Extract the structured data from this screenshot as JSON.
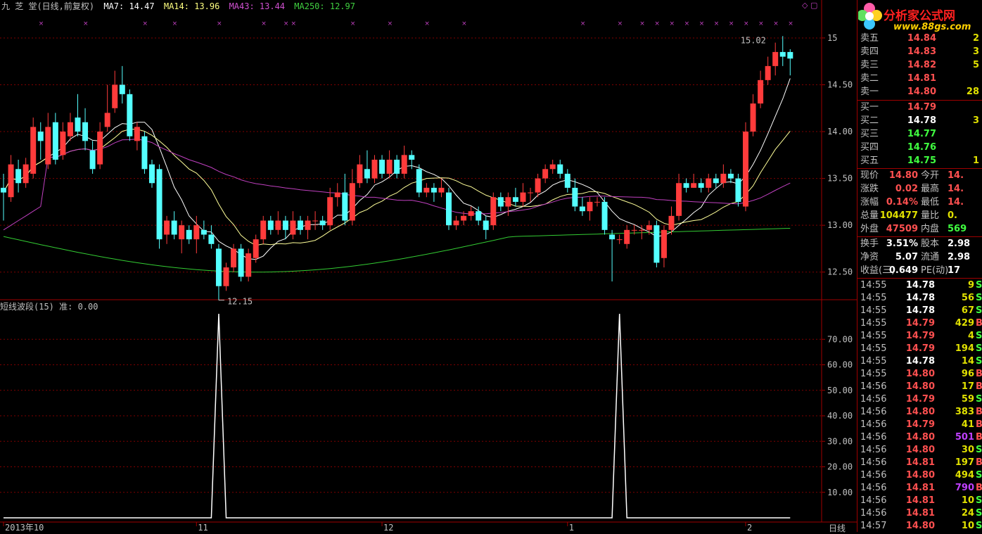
{
  "header": {
    "name": "九 芝 堂(日线,前复权)",
    "ma7": "MA7: 14.47",
    "ma14": "MA14: 13.96",
    "ma43": "MA43: 13.44",
    "ma250": "MA250: 12.97"
  },
  "indicator_title": "短线波段(15) 准: 0.00",
  "period_label": "日线",
  "colors": {
    "up": "#ff3b3b",
    "down": "#54ffff",
    "ma7": "#ffffff",
    "ma14": "#ffff99",
    "ma43": "#c040c0",
    "ma250": "#33cc33",
    "grid": "#800000"
  },
  "chart_data": [
    {
      "type": "candlestick",
      "price_axis": {
        "ticks": [
          15,
          14.5,
          14,
          13.5,
          13,
          12.5
        ],
        "tick_labels": [
          "15",
          "14.50",
          "14.00",
          "13.50",
          "13.00",
          "12.50"
        ],
        "range": [
          12.22,
          15.27
        ]
      },
      "x_ticks": [
        "2013年10",
        "11",
        "12",
        "1",
        "2"
      ],
      "annotations": [
        "12.15",
        "15.02"
      ],
      "candles": [
        [
          13.4,
          13.35,
          13.55,
          13.05
        ],
        [
          13.3,
          13.65,
          13.75,
          13.25
        ],
        [
          13.6,
          13.45,
          13.7,
          13.35
        ],
        [
          13.45,
          13.65,
          13.72,
          13.4
        ],
        [
          13.55,
          14.05,
          14.15,
          13.5
        ],
        [
          14.0,
          13.9,
          14.1,
          13.7
        ],
        [
          13.65,
          14.05,
          14.2,
          13.6
        ],
        [
          14.1,
          13.7,
          14.2,
          13.65
        ],
        [
          13.75,
          14.0,
          14.1,
          13.7
        ],
        [
          13.95,
          14.1,
          14.2,
          13.9
        ],
        [
          14.15,
          14.0,
          14.4,
          13.95
        ],
        [
          14.1,
          13.9,
          14.25,
          13.8
        ],
        [
          13.8,
          13.6,
          13.9,
          13.55
        ],
        [
          13.65,
          14.0,
          14.1,
          13.6
        ],
        [
          14.05,
          14.2,
          14.5,
          14.0
        ],
        [
          14.25,
          14.5,
          14.65,
          14.2
        ],
        [
          14.5,
          14.4,
          14.7,
          14.3
        ],
        [
          14.4,
          13.95,
          14.45,
          13.9
        ],
        [
          13.9,
          14.05,
          14.1,
          13.8
        ],
        [
          13.95,
          13.6,
          14.0,
          13.55
        ],
        [
          13.65,
          13.45,
          13.7,
          13.4
        ],
        [
          13.6,
          12.85,
          13.65,
          12.75
        ],
        [
          12.9,
          13.05,
          13.1,
          12.8
        ],
        [
          13.05,
          12.9,
          13.15,
          12.85
        ],
        [
          12.85,
          13.0,
          13.05,
          12.7
        ],
        [
          12.95,
          12.85,
          13.0,
          12.8
        ],
        [
          12.85,
          13.0,
          13.1,
          12.7
        ],
        [
          12.95,
          12.9,
          13.05,
          12.85
        ],
        [
          12.9,
          12.8,
          13.0,
          12.75
        ],
        [
          12.75,
          12.35,
          12.8,
          12.2
        ],
        [
          12.35,
          12.55,
          12.6,
          12.3
        ],
        [
          12.55,
          12.75,
          12.8,
          12.5
        ],
        [
          12.75,
          12.45,
          12.8,
          12.4
        ],
        [
          12.45,
          12.7,
          12.75,
          12.4
        ],
        [
          12.65,
          12.85,
          12.9,
          12.6
        ],
        [
          12.85,
          13.05,
          13.1,
          12.8
        ],
        [
          13.05,
          12.95,
          13.1,
          12.9
        ],
        [
          12.95,
          13.05,
          13.15,
          12.9
        ],
        [
          13.05,
          12.95,
          13.1,
          12.85
        ],
        [
          12.9,
          13.05,
          13.15,
          12.85
        ],
        [
          13.05,
          12.95,
          13.1,
          12.9
        ],
        [
          12.95,
          13.05,
          13.1,
          12.85
        ],
        [
          13.05,
          13.05,
          13.15,
          12.95
        ],
        [
          13.05,
          13.0,
          13.1,
          12.95
        ],
        [
          13.0,
          13.3,
          13.4,
          12.95
        ],
        [
          13.3,
          13.35,
          13.45,
          13.2
        ],
        [
          13.35,
          13.05,
          13.55,
          13.0
        ],
        [
          13.05,
          13.45,
          13.6,
          13.0
        ],
        [
          13.45,
          13.65,
          13.75,
          13.4
        ],
        [
          13.6,
          13.5,
          13.8,
          13.45
        ],
        [
          13.5,
          13.7,
          13.75,
          13.45
        ],
        [
          13.7,
          13.55,
          13.75,
          13.5
        ],
        [
          13.55,
          13.7,
          13.8,
          13.5
        ],
        [
          13.7,
          13.55,
          13.75,
          13.5
        ],
        [
          13.55,
          13.75,
          13.85,
          13.5
        ],
        [
          13.75,
          13.7,
          13.8,
          13.6
        ],
        [
          13.6,
          13.35,
          13.65,
          13.3
        ],
        [
          13.35,
          13.4,
          13.45,
          13.3
        ],
        [
          13.4,
          13.35,
          13.45,
          13.25
        ],
        [
          13.35,
          13.4,
          13.5,
          13.3
        ],
        [
          13.35,
          13.0,
          13.4,
          12.95
        ],
        [
          13.0,
          13.05,
          13.1,
          12.95
        ],
        [
          13.05,
          13.1,
          13.15,
          13.0
        ],
        [
          13.1,
          13.15,
          13.2,
          13.05
        ],
        [
          13.15,
          13.05,
          13.2,
          13.0
        ],
        [
          13.05,
          12.95,
          13.1,
          12.85
        ],
        [
          13.0,
          13.3,
          13.35,
          12.95
        ],
        [
          13.3,
          13.2,
          13.35,
          13.15
        ],
        [
          13.2,
          13.3,
          13.35,
          13.1
        ],
        [
          13.3,
          13.25,
          13.4,
          13.2
        ],
        [
          13.25,
          13.35,
          13.45,
          13.2
        ],
        [
          13.35,
          13.35,
          13.4,
          13.25
        ],
        [
          13.35,
          13.5,
          13.55,
          13.3
        ],
        [
          13.5,
          13.6,
          13.65,
          13.45
        ],
        [
          13.6,
          13.65,
          13.7,
          13.55
        ],
        [
          13.65,
          13.55,
          13.7,
          13.5
        ],
        [
          13.55,
          13.4,
          13.6,
          13.35
        ],
        [
          13.4,
          13.2,
          13.5,
          13.15
        ],
        [
          13.2,
          13.15,
          13.3,
          13.1
        ],
        [
          13.15,
          13.25,
          13.3,
          13.05
        ],
        [
          13.25,
          13.25,
          13.3,
          13.2
        ],
        [
          13.25,
          12.95,
          13.3,
          12.9
        ],
        [
          12.9,
          12.85,
          12.95,
          12.4
        ],
        [
          12.85,
          12.85,
          12.9,
          12.8
        ],
        [
          12.8,
          12.95,
          13.0,
          12.75
        ],
        [
          12.95,
          12.95,
          13.0,
          12.9
        ],
        [
          12.95,
          12.95,
          13.0,
          12.85
        ],
        [
          12.95,
          13.0,
          13.05,
          12.9
        ],
        [
          13.0,
          12.6,
          13.05,
          12.55
        ],
        [
          12.65,
          12.95,
          13.0,
          12.55
        ],
        [
          12.95,
          13.1,
          13.2,
          12.9
        ],
        [
          13.1,
          13.45,
          13.55,
          13.05
        ],
        [
          13.45,
          13.4,
          13.5,
          13.35
        ],
        [
          13.4,
          13.45,
          13.55,
          13.4
        ],
        [
          13.45,
          13.4,
          13.5,
          13.35
        ],
        [
          13.4,
          13.5,
          13.55,
          13.35
        ],
        [
          13.5,
          13.45,
          13.55,
          13.4
        ],
        [
          13.45,
          13.55,
          13.65,
          13.4
        ],
        [
          13.55,
          13.5,
          13.6,
          13.45
        ],
        [
          13.5,
          13.25,
          13.55,
          13.2
        ],
        [
          13.2,
          14.0,
          14.1,
          13.15
        ],
        [
          14.0,
          14.3,
          14.4,
          13.95
        ],
        [
          14.3,
          14.55,
          14.65,
          14.25
        ],
        [
          14.55,
          14.7,
          14.8,
          14.5
        ],
        [
          14.7,
          14.85,
          14.95,
          14.6
        ],
        [
          14.85,
          14.8,
          15.02,
          14.7
        ],
        [
          14.85,
          14.78,
          14.88,
          14.6
        ]
      ],
      "ma_values_last": {
        "MA7": 14.47,
        "MA14": 13.96,
        "MA43": 13.44,
        "MA250": 12.97
      }
    },
    {
      "type": "line",
      "name": "短线波段",
      "y_ticks": [
        10,
        20,
        30,
        40,
        50,
        60,
        70
      ],
      "y_tick_labels": [
        "10.00",
        "20.00",
        "30.00",
        "40.00",
        "50.00",
        "60.00",
        "70.00"
      ],
      "y_range": [
        0,
        80
      ],
      "spikes": [
        {
          "index": 29,
          "value": 80
        },
        {
          "index": 83,
          "value": 80
        }
      ],
      "baseline": 0
    }
  ],
  "panel": {
    "logo": "分析家公式网",
    "logo_url": "www.88gs.com",
    "sell": [
      {
        "label": "卖五",
        "price": "14.84",
        "qty": "2"
      },
      {
        "label": "卖四",
        "price": "14.83",
        "qty": "3"
      },
      {
        "label": "卖三",
        "price": "14.82",
        "qty": "5"
      },
      {
        "label": "卖二",
        "price": "14.81",
        "qty": ""
      },
      {
        "label": "卖一",
        "price": "14.80",
        "qty": "28"
      }
    ],
    "buy": [
      {
        "label": "买一",
        "price": "14.79",
        "qty": "",
        "color": "#ff5050"
      },
      {
        "label": "买二",
        "price": "14.78",
        "qty": "3",
        "color": "#ffffff"
      },
      {
        "label": "买三",
        "price": "14.77",
        "qty": "",
        "color": "#40ff40"
      },
      {
        "label": "买四",
        "price": "14.76",
        "qty": "",
        "color": "#40ff40"
      },
      {
        "label": "买五",
        "price": "14.75",
        "qty": "1",
        "color": "#40ff40"
      }
    ],
    "quote": [
      {
        "l1": "现价",
        "v1": "14.80",
        "c1": "#ff5050",
        "l2": "今开",
        "v2": "14.",
        "c2": "#ff5050"
      },
      {
        "l1": "涨跌",
        "v1": "0.02",
        "c1": "#ff5050",
        "l2": "最高",
        "v2": "14.",
        "c2": "#ff5050"
      },
      {
        "l1": "涨幅",
        "v1": "0.14%",
        "c1": "#ff5050",
        "l2": "最低",
        "v2": "14.",
        "c2": "#ff5050"
      },
      {
        "l1": "总量",
        "v1": "104477",
        "c1": "#e0e000",
        "l2": "量比",
        "v2": "0.",
        "c2": "#e0e000"
      },
      {
        "l1": "外盘",
        "v1": "47509",
        "c1": "#ff5050",
        "l2": "内盘",
        "v2": "569",
        "c2": "#40ff40"
      }
    ],
    "quote2": [
      {
        "l1": "换手",
        "v1": "3.51%",
        "l2": "股本",
        "v2": "2.98"
      },
      {
        "l1": "净资",
        "v1": "5.07",
        "l2": "流通",
        "v2": "2.98"
      },
      {
        "l1": "收益(三)",
        "v1": "0.649",
        "l2": "PE(动)",
        "v2": "17"
      }
    ],
    "ticks": [
      {
        "t": "14:55",
        "p": "14.78",
        "v": "9",
        "f": "S",
        "pc": "#ffffff",
        "vc": "#e0e000"
      },
      {
        "t": "14:55",
        "p": "14.78",
        "v": "56",
        "f": "S",
        "pc": "#ffffff",
        "vc": "#e0e000"
      },
      {
        "t": "14:55",
        "p": "14.78",
        "v": "67",
        "f": "S",
        "pc": "#ffffff",
        "vc": "#e0e000"
      },
      {
        "t": "14:55",
        "p": "14.79",
        "v": "429",
        "f": "B",
        "pc": "#ff5050",
        "vc": "#e0e000"
      },
      {
        "t": "14:55",
        "p": "14.79",
        "v": "4",
        "f": "S",
        "pc": "#ff5050",
        "vc": "#e0e000"
      },
      {
        "t": "14:55",
        "p": "14.79",
        "v": "194",
        "f": "S",
        "pc": "#ff5050",
        "vc": "#e0e000"
      },
      {
        "t": "14:55",
        "p": "14.78",
        "v": "14",
        "f": "S",
        "pc": "#ffffff",
        "vc": "#e0e000"
      },
      {
        "t": "14:55",
        "p": "14.80",
        "v": "96",
        "f": "B",
        "pc": "#ff5050",
        "vc": "#e0e000"
      },
      {
        "t": "14:56",
        "p": "14.80",
        "v": "17",
        "f": "B",
        "pc": "#ff5050",
        "vc": "#e0e000"
      },
      {
        "t": "14:56",
        "p": "14.79",
        "v": "59",
        "f": "S",
        "pc": "#ff5050",
        "vc": "#e0e000"
      },
      {
        "t": "14:56",
        "p": "14.80",
        "v": "383",
        "f": "B",
        "pc": "#ff5050",
        "vc": "#e0e000"
      },
      {
        "t": "14:56",
        "p": "14.79",
        "v": "41",
        "f": "B",
        "pc": "#ff5050",
        "vc": "#e0e000"
      },
      {
        "t": "14:56",
        "p": "14.80",
        "v": "501",
        "f": "B",
        "pc": "#ff5050",
        "vc": "#c040ff"
      },
      {
        "t": "14:56",
        "p": "14.80",
        "v": "30",
        "f": "S",
        "pc": "#ff5050",
        "vc": "#e0e000"
      },
      {
        "t": "14:56",
        "p": "14.81",
        "v": "197",
        "f": "B",
        "pc": "#ff5050",
        "vc": "#e0e000"
      },
      {
        "t": "14:56",
        "p": "14.80",
        "v": "494",
        "f": "S",
        "pc": "#ff5050",
        "vc": "#e0e000"
      },
      {
        "t": "14:56",
        "p": "14.81",
        "v": "790",
        "f": "B",
        "pc": "#ff5050",
        "vc": "#c040ff"
      },
      {
        "t": "14:56",
        "p": "14.81",
        "v": "10",
        "f": "S",
        "pc": "#ff5050",
        "vc": "#e0e000"
      },
      {
        "t": "14:56",
        "p": "14.81",
        "v": "24",
        "f": "S",
        "pc": "#ff5050",
        "vc": "#e0e000"
      },
      {
        "t": "14:57",
        "p": "14.80",
        "v": "10",
        "f": "S",
        "pc": "#ff5050",
        "vc": "#e0e000"
      }
    ]
  }
}
